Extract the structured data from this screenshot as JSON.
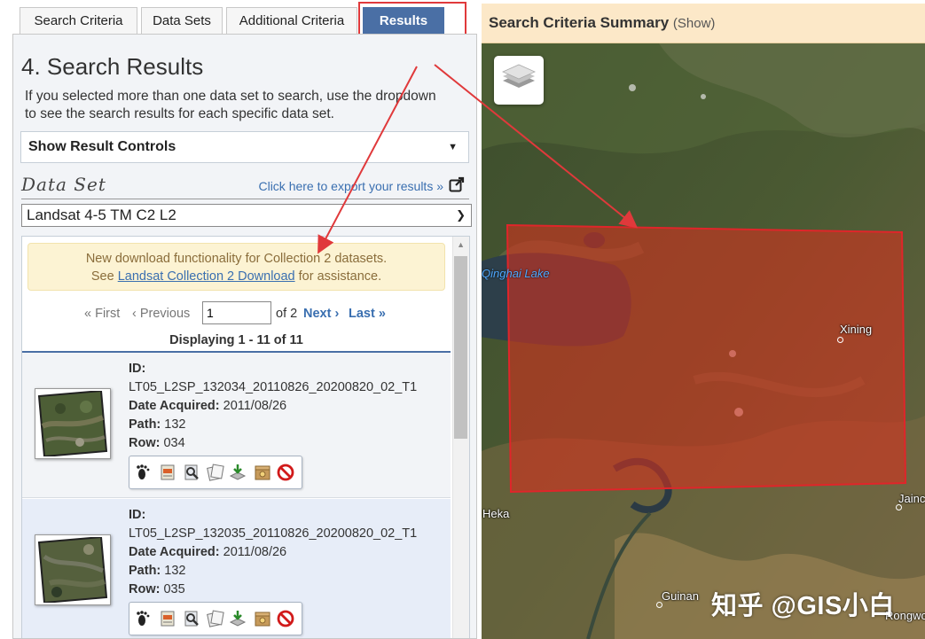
{
  "tabs": [
    {
      "label": "Search Criteria",
      "active": false
    },
    {
      "label": "Data Sets",
      "active": false
    },
    {
      "label": "Additional Criteria",
      "active": false
    },
    {
      "label": "Results",
      "active": true
    }
  ],
  "results_panel": {
    "title": "4. Search Results",
    "intro": "If you selected more than one data set to search, use the dropdown to see the search results for each specific data set.",
    "controls_label": "Show Result Controls",
    "data_set_label": "Data Set",
    "export_link": "Click here to export your results »",
    "data_set_selected": "Landsat 4-5 TM C2 L2",
    "notice_line1": "New download functionality for Collection 2 datasets.",
    "notice_see": "See",
    "notice_link": "Landsat Collection 2 Download",
    "notice_tail": "for assistance.",
    "pagination": {
      "first": "« First",
      "previous": "‹ Previous",
      "page_value": "1",
      "of": "of 2",
      "next": "Next ›",
      "last": "Last »"
    },
    "displaying": "Displaying 1 - 11 of 11",
    "labels": {
      "id": "ID:",
      "date_acquired": "Date Acquired:",
      "path": "Path:",
      "row": "Row:"
    },
    "results": [
      {
        "id": "LT05_L2SP_132034_20110826_20200820_02_T1",
        "date_acquired": "2011/08/26",
        "path": "132",
        "row": "034"
      },
      {
        "id": "LT05_L2SP_132035_20110826_20200820_02_T1",
        "date_acquired": "2011/08/26",
        "path": "132",
        "row": "035"
      }
    ],
    "action_icons": [
      "footprint-icon",
      "metadata-icon",
      "browse-overlay-icon",
      "compare-icon",
      "download-icon",
      "order-icon",
      "exclude-icon"
    ]
  },
  "map_panel": {
    "summary_title": "Search Criteria Summary",
    "summary_show": "(Show)",
    "labels": {
      "qinghai_lake": "Qinghai Lake",
      "xining": "Xining",
      "heka": "Heka",
      "guinan": "Guinan",
      "jainca": "Jainc",
      "rongwo": "Rongwo"
    },
    "footprint_color": "#d9301e"
  },
  "watermark": "知乎 @GIS小白",
  "colors": {
    "tab_active": "#4a6fa5",
    "annotation_red": "#e0393b",
    "link": "#3a6fb0",
    "notice_bg": "#fcf3d3"
  }
}
